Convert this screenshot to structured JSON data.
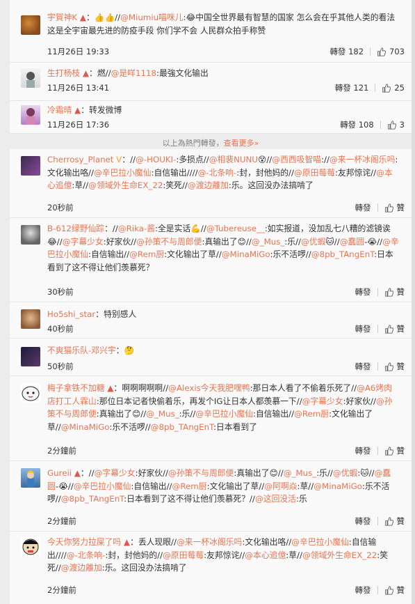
{
  "comments": [
    {
      "user": "宇賀神K",
      "sep": "：",
      "segments": [
        {
          "t": "👍👍//"
        },
        {
          "m": "@Miumiu喵咪儿"
        },
        {
          "t": ":"
        },
        {
          "e": "😂"
        },
        {
          "t": "中国全世界最有智慧的国家 怎么会在乎其他人类的看法 这是全宇宙最先进的防疫手段 你们学不会 人民群众拍手称赞"
        }
      ],
      "time": "11月26日 19:33",
      "repost": "轉發 182",
      "likes": "703"
    },
    {
      "user": "生打杨枝",
      "sep": "：",
      "segments": [
        {
          "t": "燃//"
        },
        {
          "m": "@是咩1118"
        },
        {
          "t": ":最強文化输出"
        }
      ],
      "time": "11月26日 13:41",
      "repost": "轉發 121",
      "likes": "25"
    },
    {
      "user": "冷霜晴",
      "sep": "：",
      "segments": [
        {
          "t": "转发微博"
        }
      ],
      "time": "11月26日 17:36",
      "repost": "轉發 108",
      "likes": "3"
    },
    {
      "user": "Cherrosy_Planet",
      "sep": "：",
      "segments": [
        {
          "t": "//"
        },
        {
          "m": "@-HOUKI-"
        },
        {
          "t": ":多损点//"
        },
        {
          "m": "@相裴NUNU"
        },
        {
          "e": "😵"
        },
        {
          "t": "//"
        },
        {
          "m": "@西西吸智喵"
        },
        {
          "t": "://"
        },
        {
          "m": "@来一杯冰阁乐吗"
        },
        {
          "t": ":文化输出咯//"
        },
        {
          "m": "@辛巴拉小魔仙"
        },
        {
          "t": ":自信输出////"
        },
        {
          "m": "@-北条响-"
        },
        {
          "t": ":封，封他妈的//"
        },
        {
          "m": "@原田莓莓"
        },
        {
          "t": ":友邦惊诧//"
        },
        {
          "m": "@本心追億"
        },
        {
          "t": ":草//"
        },
        {
          "m": "@领域外生命EX_22"
        },
        {
          "t": ":笑死//"
        },
        {
          "m": "@渡边離加"
        },
        {
          "t": ":乐。这回没办法搞啃了"
        }
      ],
      "time": "20秒前",
      "repost": "轉發",
      "likes": "贊"
    },
    {
      "user": "B-612绿野仙踪",
      "sep": "：",
      "segments": [
        {
          "t": "//"
        },
        {
          "m": "@Rika-酱"
        },
        {
          "t": ":全是实话"
        },
        {
          "e": "💪"
        },
        {
          "t": "//"
        },
        {
          "m": "@Tubereuse__"
        },
        {
          "t": ":如实报道，没加乱七八糟的滤镜诶"
        },
        {
          "e": "😂"
        },
        {
          "t": "//"
        },
        {
          "m": "@字幕少女"
        },
        {
          "t": ":好家伙//"
        },
        {
          "m": "@孙策不与周郎便"
        },
        {
          "t": ":真输出了"
        },
        {
          "e": "😊"
        },
        {
          "t": "//"
        },
        {
          "m": "@_Mus_"
        },
        {
          "t": ":乐//"
        },
        {
          "m": "@优蝦"
        },
        {
          "e": "🐱"
        },
        {
          "t": "//"
        },
        {
          "m": "@蠢圆"
        },
        {
          "t": "-"
        },
        {
          "e": "😭"
        },
        {
          "t": "//"
        },
        {
          "m": "@辛巴拉小魔仙"
        },
        {
          "t": ":自信输出//"
        },
        {
          "m": "@Rem厨"
        },
        {
          "t": ":文化输出了草//"
        },
        {
          "m": "@MinaMiGo"
        },
        {
          "t": ":乐不活啰//"
        },
        {
          "m": "@8pb_TAngEnT"
        },
        {
          "t": ":日本看到了这不得让他们羡慕死？"
        }
      ],
      "time": "30秒前",
      "repost": "轉發",
      "likes": "贊"
    },
    {
      "user": "Ho5shi_star",
      "sep": "：",
      "segments": [
        {
          "t": "特别感人"
        }
      ],
      "time": "40秒前",
      "repost": "轉發",
      "likes": "贊"
    },
    {
      "user": "不爽猫乐队-邓兴宇",
      "sep": "：",
      "segments": [
        {
          "e": "🤔"
        }
      ],
      "time": "50秒前",
      "repost": "轉發",
      "likes": "贊"
    },
    {
      "user": "梅子拿铁不加糖",
      "sep": "：",
      "segments": [
        {
          "t": "啊啊啊啊啊//"
        },
        {
          "m": "@Alexis今天我肥嘿鸭"
        },
        {
          "t": ":那日本人看了不偷着乐死了//"
        },
        {
          "m": "@A6烤肉店打工人霖山"
        },
        {
          "t": ":那位日本记者快偷着乐，再发个IG让日本人都羡慕一下//"
        },
        {
          "m": "@字幕少女"
        },
        {
          "t": ":好家伙//"
        },
        {
          "m": "@孙策不与周郎便"
        },
        {
          "t": ":真输出了"
        },
        {
          "e": "😊"
        },
        {
          "t": "//"
        },
        {
          "m": "@_Mus_"
        },
        {
          "t": ":乐//"
        },
        {
          "m": "@辛巴拉小魔仙"
        },
        {
          "t": ":自信输出//"
        },
        {
          "m": "@Rem厨"
        },
        {
          "t": ":文化输出了草//"
        },
        {
          "m": "@MinaMiGo"
        },
        {
          "t": ":乐不活啰//"
        },
        {
          "m": "@8pb_TAngEnT"
        },
        {
          "t": ":日本看到了"
        }
      ],
      "time": "2分鐘前",
      "repost": "轉發",
      "likes": "贊"
    },
    {
      "user": "Gureii",
      "sep": "：",
      "segments": [
        {
          "t": "//"
        },
        {
          "m": "@字幕少女"
        },
        {
          "t": ":好家伙//"
        },
        {
          "m": "@孙策不与周郎便"
        },
        {
          "t": ":真输出了"
        },
        {
          "e": "😊"
        },
        {
          "t": "//"
        },
        {
          "m": "@_Mus_"
        },
        {
          "t": ":乐//"
        },
        {
          "m": "@优蝦"
        },
        {
          "t": ":"
        },
        {
          "e": "🐱"
        },
        {
          "t": "//"
        },
        {
          "m": "@蠢圆"
        },
        {
          "t": "-"
        },
        {
          "e": "😭"
        },
        {
          "t": "//"
        },
        {
          "m": "@辛巴拉小魔仙"
        },
        {
          "t": ":自信输出//"
        },
        {
          "m": "@Rem厨"
        },
        {
          "t": ":文化输出了草//"
        },
        {
          "m": "@阿啊焱"
        },
        {
          "t": ":草//"
        },
        {
          "m": "@MinaMiGo"
        },
        {
          "t": ":乐不活啰//"
        },
        {
          "m": "@8pb_TAngEnT"
        },
        {
          "t": ":日本看到了这不得让他们羡慕死？//"
        },
        {
          "m": "@这回没活"
        },
        {
          "t": ":乐"
        }
      ],
      "time": "2分鐘前",
      "repost": "轉發",
      "likes": "贊"
    },
    {
      "user": "今天你努力拉屎了吗",
      "sep": "：",
      "segments": [
        {
          "t": "丢人现眼//"
        },
        {
          "m": "@来一杯冰阁乐吗"
        },
        {
          "t": ":文化输出咯//"
        },
        {
          "m": "@辛巴拉小魔仙"
        },
        {
          "t": ":自信输出////"
        },
        {
          "m": "@-北条响-"
        },
        {
          "t": ":封，封他妈的//"
        },
        {
          "m": "@原田莓莓"
        },
        {
          "t": ":友邦惊诧//"
        },
        {
          "m": "@本心追億"
        },
        {
          "t": ":草//"
        },
        {
          "m": "@领域外生命EX_22"
        },
        {
          "t": ":笑死//"
        },
        {
          "m": "@渡边離加"
        },
        {
          "t": ":乐。这回没办法搞啃了"
        }
      ],
      "time": "2分鐘前",
      "repost": "轉發",
      "likes": "贊"
    }
  ],
  "divider": {
    "text": "以上為熱門轉發，",
    "more": "查看更多»"
  },
  "colors": {
    "accent": "#eb7350",
    "background": "#f9f9f9",
    "text": "#333333"
  }
}
